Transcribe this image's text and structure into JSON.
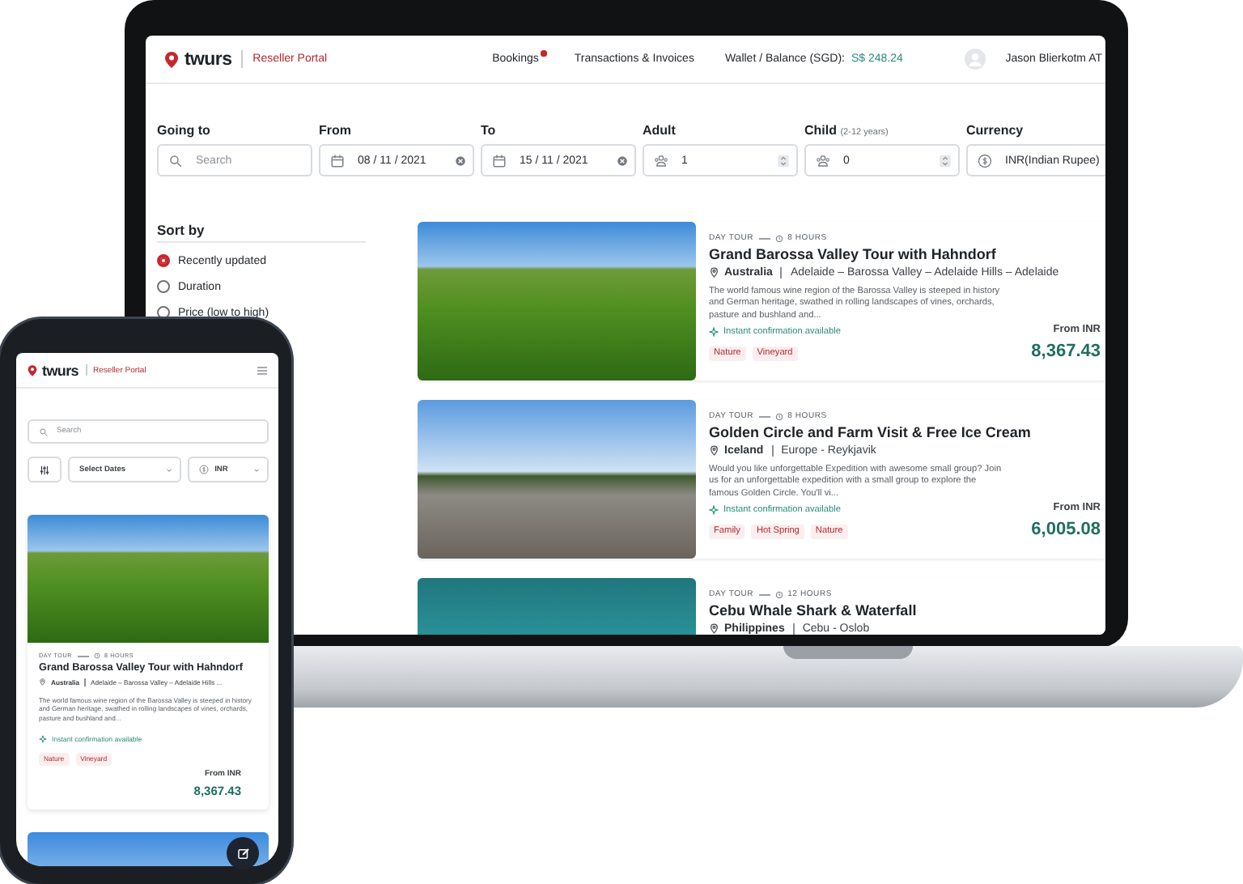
{
  "laptop": {
    "header": {
      "logo": "twurs",
      "portal": "Reseller Portal",
      "nav": [
        {
          "label": "Bookings",
          "badge": true
        },
        {
          "label": "Transactions & Invoices",
          "badge": false
        }
      ],
      "wallet_label": "Wallet / Balance (SGD):",
      "wallet_value": "S$ 248.24",
      "user_name": "Jason Blierkotm AT"
    },
    "filters": [
      {
        "kind": "search",
        "label": "Going to",
        "placeholder": "Search"
      },
      {
        "kind": "date",
        "label": "From",
        "value": "08 / 11 / 2021"
      },
      {
        "kind": "date",
        "label": "To",
        "value": "15 / 11 / 2021"
      },
      {
        "kind": "count",
        "label": "Adult",
        "value": "1"
      },
      {
        "kind": "count",
        "label": "Child",
        "note": "(2-12 years)",
        "value": "0"
      },
      {
        "kind": "currency",
        "label": "Currency",
        "value": "INR(Indian Rupee)"
      }
    ],
    "sort": {
      "title": "Sort by",
      "options": [
        {
          "label": "Recently updated",
          "selected": true
        },
        {
          "label": "Duration",
          "selected": false
        },
        {
          "label": "Price (low to high)",
          "selected": false
        }
      ]
    },
    "tours": [
      {
        "type": "DAY TOUR",
        "duration": "8 HOURS",
        "title": "Grand Barossa Valley Tour with Hahndorf",
        "country": "Australia",
        "route": "Adelaide – Barossa Valley – Adelaide Hills – Adelaide",
        "description": "The world famous wine region of the Barossa Valley is steeped in history and German heritage, swathed in rolling landscapes of vines, orchards, pasture and bushland and...",
        "confirmation": "Instant confirmation available",
        "tags": [
          "Nature",
          "Vineyard"
        ],
        "price_label": "From INR",
        "price": "8,367.43"
      },
      {
        "type": "DAY TOUR",
        "duration": "8 HOURS",
        "title": "Golden Circle and Farm Visit & Free Ice Cream",
        "country": "Iceland",
        "route": "Europe - Reykjavik",
        "description": "Would you like unforgettable Expedition with awesome small group? Join us for an unforgettable expedition with a small group to explore the famous Golden Circle. You'll vi...",
        "confirmation": "Instant confirmation available",
        "tags": [
          "Family",
          "Hot Spring",
          "Nature"
        ],
        "price_label": "From INR",
        "price": "6,005.08"
      },
      {
        "type": "DAY TOUR",
        "duration": "12 HOURS",
        "title": "Cebu Whale Shark & Waterfall",
        "country": "Philippines",
        "route": "Cebu - Oslob"
      }
    ]
  },
  "phone": {
    "header": {
      "logo": "twurs",
      "portal": "Reseller Portal"
    },
    "search": {
      "placeholder": "Search"
    },
    "dates": "Select Dates",
    "currency": "INR",
    "tours": [
      {
        "type": "DAY TOUR",
        "duration": "8 HOURS",
        "title": "Grand Barossa Valley Tour with Hahndorf",
        "country": "Australia",
        "route": "Adelaide – Barossa Valley – Adelaide Hills ...",
        "description": "The world famous wine region of the Barossa Valley is steeped in history and German heritage, swathed in rolling landscapes of vines, orchards, pasture and bushland and...",
        "confirmation": "Instant confirmation available",
        "tags": [
          "Nature",
          "Vineyard"
        ],
        "price_label": "From INR",
        "price": "8,367.43"
      }
    ]
  }
}
